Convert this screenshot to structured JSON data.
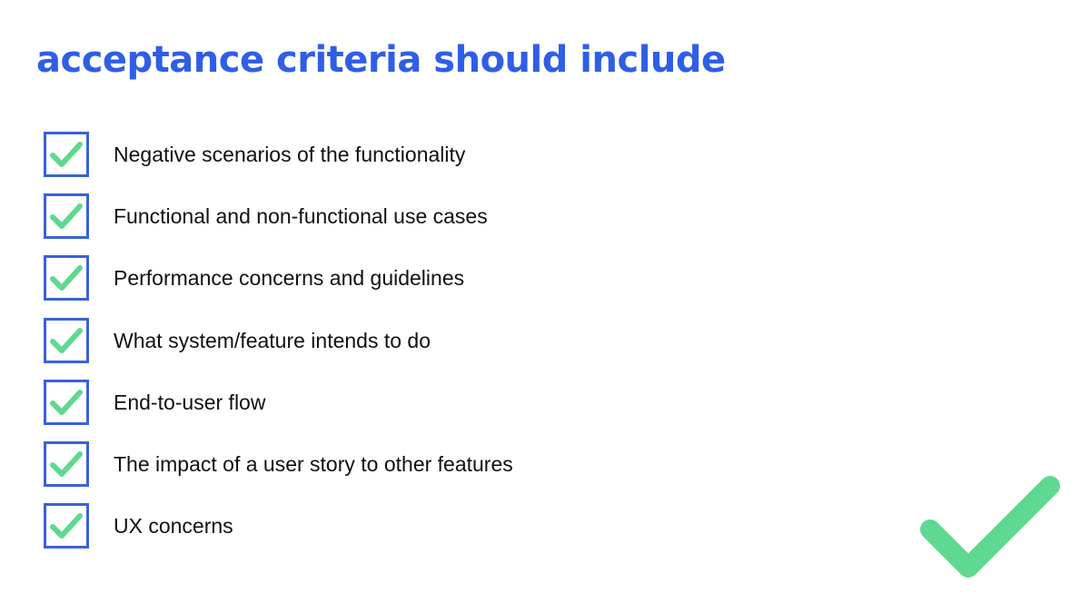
{
  "title": "acceptance criteria should include",
  "items": [
    {
      "label": "Negative scenarios of the functionality"
    },
    {
      "label": "Functional and non-functional use cases"
    },
    {
      "label": "Performance concerns and guidelines"
    },
    {
      "label": "What system/feature intends to do"
    },
    {
      "label": "End-to-user flow"
    },
    {
      "label": "The impact of a user story to other features"
    },
    {
      "label": "UX concerns"
    }
  ],
  "colors": {
    "title": "#2f5ee6",
    "checkbox_border": "#3a62d6",
    "checkmark": "#5fd98f"
  },
  "icons": {
    "item_icon": "checked-box-icon",
    "decoration": "check-mark-icon"
  }
}
